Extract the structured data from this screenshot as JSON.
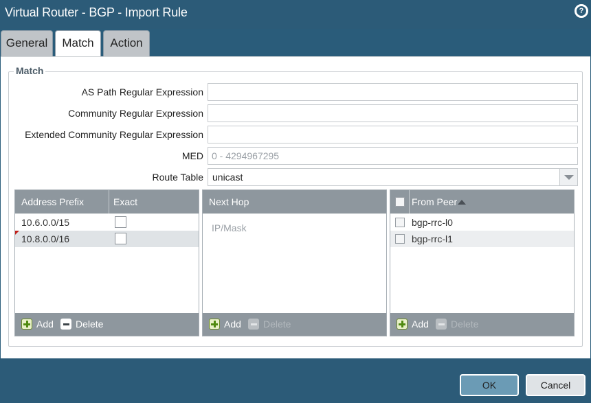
{
  "window": {
    "title": "Virtual Router - BGP - Import Rule",
    "help_icon": "question-circle-icon"
  },
  "tabs": [
    {
      "label": "General",
      "active": false
    },
    {
      "label": "Match",
      "active": true
    },
    {
      "label": "Action",
      "active": false
    }
  ],
  "match": {
    "legend": "Match",
    "as_path": {
      "label": "AS Path Regular Expression",
      "value": ""
    },
    "community": {
      "label": "Community Regular Expression",
      "value": ""
    },
    "ext_community": {
      "label": "Extended Community Regular Expression",
      "value": ""
    },
    "med": {
      "label": "MED",
      "value": "",
      "placeholder": "0 - 4294967295"
    },
    "route_table": {
      "label": "Route Table",
      "value": "unicast"
    }
  },
  "address_prefix_grid": {
    "columns": [
      "Address Prefix",
      "Exact"
    ],
    "rows": [
      {
        "prefix": "10.6.0.0/15",
        "exact": false
      },
      {
        "prefix": "10.8.0.0/16",
        "exact": false
      }
    ],
    "add_label": "Add",
    "delete_label": "Delete"
  },
  "next_hop_grid": {
    "header": "Next Hop",
    "placeholder": "IP/Mask",
    "add_label": "Add",
    "delete_label": "Delete"
  },
  "from_peer_grid": {
    "header": "From Peer",
    "rows": [
      "bgp-rrc-l0",
      "bgp-rrc-l1"
    ],
    "add_label": "Add",
    "delete_label": "Delete"
  },
  "footer": {
    "ok_label": "OK",
    "cancel_label": "Cancel"
  },
  "colors": {
    "titlebar": "#2c5b78",
    "grid_header": "#8e979e",
    "ok_button": "#6b9bb5"
  }
}
